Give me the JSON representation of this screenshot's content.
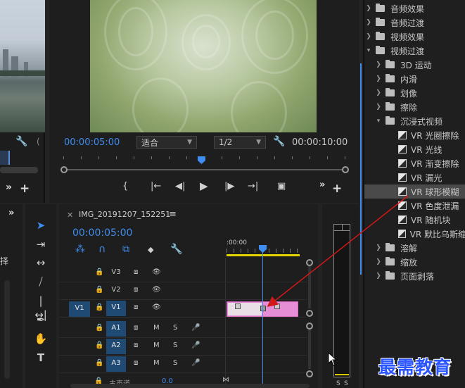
{
  "program_monitor": {
    "timecode_current": "00:00:05:00",
    "zoom_select": "适合",
    "resolution_select": "1/2",
    "timecode_duration": "00:00:10:00"
  },
  "timeline": {
    "sequence_name": "IMG_20191207_152251",
    "timecode": "00:00:05:00",
    "ruler_start": ":00:00",
    "video_tracks": [
      "V3",
      "V2",
      "V1"
    ],
    "audio_tracks": [
      "A1",
      "A2",
      "A3"
    ],
    "source_patch": "V1",
    "mute_label": "M",
    "solo_label": "S",
    "master_track_label": "主声道",
    "master_value": "0.0"
  },
  "left_panel": {
    "clipped_text": "择"
  },
  "effects_panel": {
    "items": [
      {
        "label": "音频效果",
        "expanded": false,
        "type": "folder",
        "level": 0
      },
      {
        "label": "音频过渡",
        "expanded": false,
        "type": "folder",
        "level": 0
      },
      {
        "label": "视频效果",
        "expanded": false,
        "type": "folder",
        "level": 0
      },
      {
        "label": "视频过渡",
        "expanded": true,
        "type": "folder",
        "level": 0
      },
      {
        "label": "3D 运动",
        "expanded": false,
        "type": "folder",
        "level": 1
      },
      {
        "label": "内滑",
        "expanded": false,
        "type": "folder",
        "level": 1
      },
      {
        "label": "划像",
        "expanded": false,
        "type": "folder",
        "level": 1
      },
      {
        "label": "擦除",
        "expanded": false,
        "type": "folder",
        "level": 1
      },
      {
        "label": "沉浸式视频",
        "expanded": true,
        "type": "folder",
        "level": 1
      },
      {
        "label": "VR 光圈擦除",
        "type": "effect",
        "level": 2
      },
      {
        "label": "VR 光线",
        "type": "effect",
        "level": 2
      },
      {
        "label": "VR 渐变擦除",
        "type": "effect",
        "level": 2
      },
      {
        "label": "VR 漏光",
        "type": "effect",
        "level": 2
      },
      {
        "label": "VR 球形模糊",
        "type": "effect",
        "level": 2,
        "selected": true
      },
      {
        "label": "VR 色度泄漏",
        "type": "effect",
        "level": 2
      },
      {
        "label": "VR 随机块",
        "type": "effect",
        "level": 2
      },
      {
        "label": "VR 默比乌斯缩",
        "type": "effect",
        "level": 2
      },
      {
        "label": "溶解",
        "expanded": false,
        "type": "folder",
        "level": 1
      },
      {
        "label": "缩放",
        "expanded": false,
        "type": "folder",
        "level": 1
      },
      {
        "label": "页面剥落",
        "expanded": false,
        "type": "folder",
        "level": 1
      }
    ]
  },
  "audio_meter": {
    "solo_labels": [
      "S",
      "S"
    ]
  },
  "watermark": "最需教育",
  "colors": {
    "accent_blue": "#3f8df0",
    "clip_pink": "#e58ed6",
    "selection_bg": "#4a4a4a",
    "annotation_red": "#d01818",
    "watermark_blue": "#2a55ff"
  },
  "icons": {
    "monitor_controls": [
      "mark-in-icon",
      "go-to-in-icon",
      "step-back-icon",
      "play-icon",
      "step-forward-icon",
      "go-to-out-icon",
      "export-frame-icon"
    ],
    "tools": [
      "selection-tool-icon",
      "track-select-icon",
      "ripple-edit-icon",
      "razor-icon",
      "slip-icon",
      "pen-icon",
      "hand-icon",
      "type-icon"
    ]
  }
}
